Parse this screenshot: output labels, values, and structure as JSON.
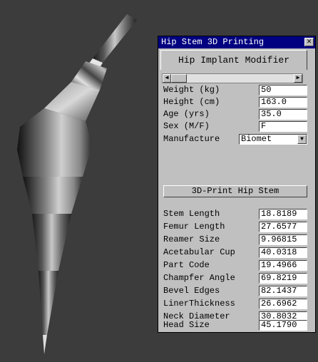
{
  "window": {
    "title": "Hip Stem 3D Printing",
    "close_glyph": "✕"
  },
  "tab": {
    "label": "Hip Implant Modifier"
  },
  "scroll": {
    "left_glyph": "◀",
    "right_glyph": "▶"
  },
  "inputs": [
    {
      "label": "Weight (kg)",
      "value": "50"
    },
    {
      "label": "Height (cm)",
      "value": "163.0"
    },
    {
      "label": "Age (yrs)",
      "value": "35.0"
    },
    {
      "label": "Sex (M/F)",
      "value": "F"
    }
  ],
  "manufacturer": {
    "label": "Manufacture",
    "value": "Biomet",
    "dropdown_glyph": "▼"
  },
  "print_button": {
    "label": "3D-Print Hip Stem"
  },
  "outputs": [
    {
      "label": "Stem Length",
      "value": "18.8189"
    },
    {
      "label": "Femur Length",
      "value": "27.6577"
    },
    {
      "label": "Reamer Size",
      "value": "9.96815"
    },
    {
      "label": "Acetabular Cup",
      "value": "40.0318"
    },
    {
      "label": "Part Code",
      "value": "19.4966"
    },
    {
      "label": "Champfer Angle",
      "value": "69.8219"
    },
    {
      "label": "Bevel Edges",
      "value": "82.1437"
    },
    {
      "label": "LinerThickness",
      "value": "26.6962"
    },
    {
      "label": "Neck Diameter",
      "value": "30.8032"
    },
    {
      "label": "Head Size",
      "value": "45.1790"
    }
  ],
  "colors": {
    "background": "#3c3c3c",
    "titlebar": "#000080",
    "panel": "#c0c0c0"
  }
}
